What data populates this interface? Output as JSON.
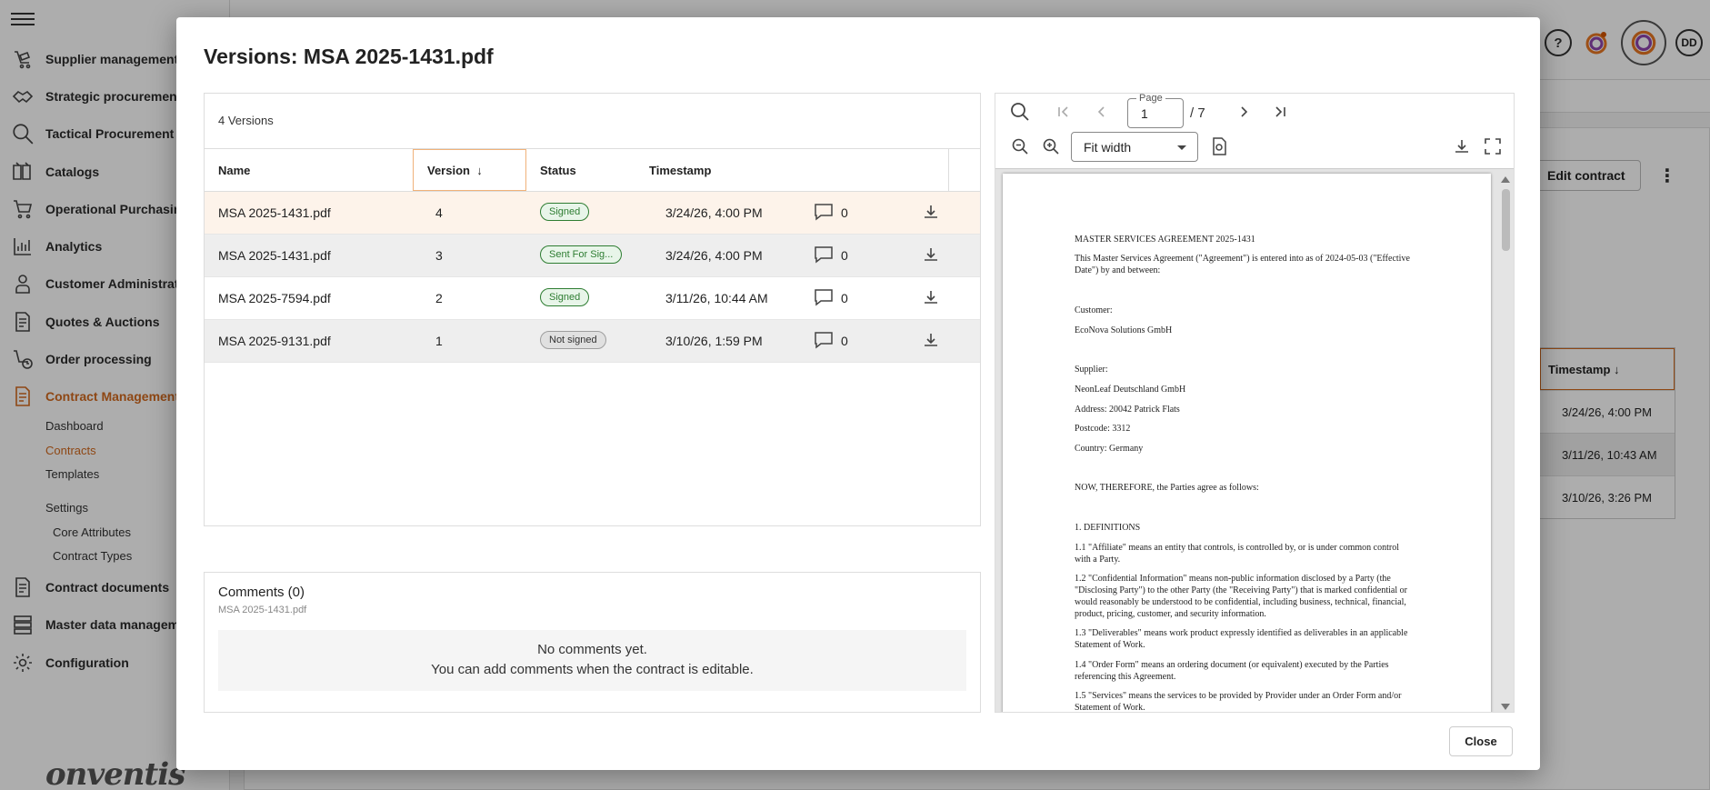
{
  "sidebar": {
    "items": [
      {
        "label": "Supplier management",
        "icon": "supplier-icon"
      },
      {
        "label": "Strategic procurement",
        "icon": "handshake-icon"
      },
      {
        "label": "Tactical Procurement",
        "icon": "magnifier-icon"
      },
      {
        "label": "Catalogs",
        "icon": "book-icon"
      },
      {
        "label": "Operational Purchasing",
        "icon": "cart-icon"
      },
      {
        "label": "Analytics",
        "icon": "chart-icon"
      },
      {
        "label": "Customer Administration",
        "icon": "person-icon"
      },
      {
        "label": "Quotes & Auctions",
        "icon": "document-icon"
      },
      {
        "label": "Order processing",
        "icon": "cart-clock-icon"
      },
      {
        "label": "Contract Management",
        "icon": "contract-icon"
      },
      {
        "label": "Contract documents",
        "icon": "document-icon"
      },
      {
        "label": "Master data management",
        "icon": "database-icon"
      },
      {
        "label": "Configuration",
        "icon": "gear-icon"
      }
    ],
    "sub_items": {
      "dashboard": "Dashboard",
      "contracts": "Contracts",
      "templates": "Templates",
      "settings": "Settings",
      "core_attributes": "Core Attributes",
      "contract_types": "Contract Types"
    },
    "brand": "onventis"
  },
  "topbar": {
    "help": "?",
    "avatar": "DD"
  },
  "background": {
    "edit_contract": "Edit contract",
    "kebab": "⋮",
    "timestamp_header": "Timestamp",
    "timestamps": [
      "3/24/26, 4:00 PM",
      "3/11/26, 10:43 AM",
      "3/10/26, 3:26 PM"
    ]
  },
  "modal": {
    "title": "Versions: MSA 2025-1431.pdf",
    "version_count": "4 Versions",
    "columns": {
      "name": "Name",
      "version": "Version",
      "status": "Status",
      "timestamp": "Timestamp"
    },
    "sort_arrow": "↓",
    "rows": [
      {
        "name": "MSA 2025-1431.pdf",
        "version": "4",
        "status": "Signed",
        "timestamp": "3/24/26, 4:00 PM",
        "comments": "0"
      },
      {
        "name": "MSA 2025-1431.pdf",
        "version": "3",
        "status": "Sent For Sig...",
        "timestamp": "3/24/26, 4:00 PM",
        "comments": "0"
      },
      {
        "name": "MSA 2025-7594.pdf",
        "version": "2",
        "status": "Signed",
        "timestamp": "3/11/26, 10:44 AM",
        "comments": "0"
      },
      {
        "name": "MSA 2025-9131.pdf",
        "version": "1",
        "status": "Not signed",
        "timestamp": "3/10/26, 1:59 PM",
        "comments": "0"
      }
    ],
    "comments": {
      "title": "Comments (0)",
      "subtitle": "MSA 2025-1431.pdf",
      "empty_line1": "No comments yet.",
      "empty_line2": "You can add comments when the contract is editable."
    },
    "close_label": "Close"
  },
  "pdf_viewer": {
    "page_label": "Page",
    "page_value": "1",
    "page_total": "/ 7",
    "fit_mode": "Fit width",
    "lines": [
      "MASTER SERVICES AGREEMENT 2025-1431",
      "This Master Services Agreement (\"Agreement\") is entered into as of 2024-05-03 (\"Effective",
      "Date\") by and between:",
      "Customer:",
      "EcoNova Solutions GmbH",
      "Supplier:",
      "NeonLeaf Deutschland GmbH",
      "Address: 20042 Patrick Flats",
      "Postcode: 3312",
      "Country: Germany",
      "NOW, THEREFORE, the Parties agree as follows:",
      "1. DEFINITIONS",
      "1.1 \"Affiliate\" means an entity that controls, is controlled by, or is under common control",
      "with a Party.",
      "1.2 \"Confidential Information\" means non-public information disclosed by a Party (the",
      "\"Disclosing Party\") to the other Party (the \"Receiving Party\") that is marked confidential or",
      "would reasonably be understood to be confidential, including business, technical, financial,",
      "product, pricing, customer, and security information.",
      "1.3 \"Deliverables\" means work product expressly identified as deliverables in an applicable",
      "Statement of Work.",
      "1.4 \"Order Form\" means an ordering document (or equivalent) executed by the Parties",
      "referencing this Agreement.",
      "1.5 \"Services\" means the services to be provided by Provider under an Order Form and/or",
      "Statement of Work."
    ]
  },
  "colors": {
    "accent": "#d2691e",
    "signed": "#2e7d32",
    "selected_row": "#fdf3ea"
  }
}
